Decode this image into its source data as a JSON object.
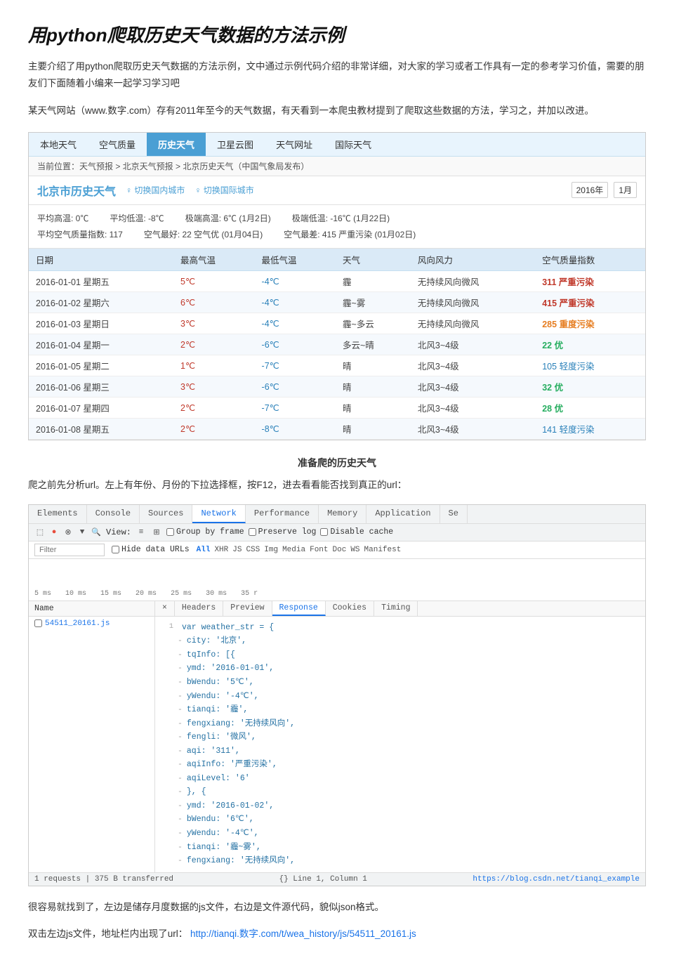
{
  "page": {
    "title_prefix": "用",
    "title_bold": "python",
    "title_suffix": "爬取历史天气数据的方法示例"
  },
  "intro": {
    "para1": "主要介绍了用python爬取历史天气数据的方法示例，文中通过示例代码介绍的非常详细，对大家的学习或者工作具有一定的参考学习价值，需要的朋友们下面随着小编来一起学习学习吧",
    "para2": "某天气网站（www.数字.com）存有2011年至今的天气数据，有天看到一本爬虫教材提到了爬取这些数据的方法，学习之，并加以改进。"
  },
  "weather_nav": {
    "items": [
      "本地天气",
      "空气质量",
      "历史天气",
      "卫星云图",
      "天气网址",
      "国际天气"
    ],
    "active": "历史天气"
  },
  "breadcrumb": {
    "text": "当前位置：天气预报 > 北京天气预报 > 北京历史天气（中国气象局发布）"
  },
  "city_header": {
    "title": "北京市历史天气",
    "switch1": "切换国内城市",
    "switch2": "切换国际城市",
    "year": "2016年",
    "month": "1月"
  },
  "stats": {
    "line1_a": "平均高温: 0℃",
    "line1_b": "平均低温: -8℃",
    "line1_c": "极端高温: 6℃ (1月2日)",
    "line1_d": "极端低温: -16℃ (1月22日)",
    "line2_a": "平均空气质量指数: 117",
    "line2_b": "空气最好: 22 空气优 (01月04日)",
    "line2_c": "空气最差: 415 严重污染 (01月02日)"
  },
  "weather_table": {
    "headers": [
      "日期",
      "最高气温",
      "最低气温",
      "天气",
      "风向风力",
      "空气质量指数"
    ],
    "rows": [
      {
        "date": "2016-01-01 星期五",
        "high": "5℃",
        "low": "-4℃",
        "weather": "霾",
        "wind": "无持续风向微风",
        "aqi": "311",
        "aqi_label": "严重污染",
        "aqi_class": "tag-red"
      },
      {
        "date": "2016-01-02 星期六",
        "high": "6℃",
        "low": "-4℃",
        "weather": "霾~雾",
        "wind": "无持续风向微风",
        "aqi": "415",
        "aqi_label": "严重污染",
        "aqi_class": "tag-red"
      },
      {
        "date": "2016-01-03 星期日",
        "high": "3℃",
        "low": "-4℃",
        "weather": "霾~多云",
        "wind": "无持续风向微风",
        "aqi": "285",
        "aqi_label": "重度污染",
        "aqi_class": "tag-orange"
      },
      {
        "date": "2016-01-04 星期一",
        "high": "2℃",
        "low": "-6℃",
        "weather": "多云~晴",
        "wind": "北风3~4级",
        "aqi": "22",
        "aqi_label": "优",
        "aqi_class": "tag-green"
      },
      {
        "date": "2016-01-05 星期二",
        "high": "1℃",
        "low": "-7℃",
        "weather": "晴",
        "wind": "北风3~4级",
        "aqi": "105",
        "aqi_label": "轻度污染",
        "aqi_class": "tag-blue"
      },
      {
        "date": "2016-01-06 星期三",
        "high": "3℃",
        "low": "-6℃",
        "weather": "晴",
        "wind": "北风3~4级",
        "aqi": "32",
        "aqi_label": "优",
        "aqi_class": "tag-green"
      },
      {
        "date": "2016-01-07 星期四",
        "high": "2℃",
        "low": "-7℃",
        "weather": "晴",
        "wind": "北风3~4级",
        "aqi": "28",
        "aqi_label": "优",
        "aqi_class": "tag-green"
      },
      {
        "date": "2016-01-08 星期五",
        "high": "2℃",
        "low": "-8℃",
        "weather": "晴",
        "wind": "北风3~4级",
        "aqi": "141",
        "aqi_label": "轻度污染",
        "aqi_class": "tag-blue"
      }
    ]
  },
  "section_heading": "准备爬的历史天气",
  "crawl_intro": "爬之前先分析url。左上有年份、月份的下拉选择框，按F12，进去看看能否找到真正的url：",
  "devtools": {
    "toolbar_icons": [
      "cursor",
      "box",
      "funnel",
      "search"
    ],
    "view_label": "View:",
    "group_by_frame": "Group by frame",
    "preserve_log": "Preserve log",
    "disable_cache": "Disable cache",
    "tabs": [
      "Elements",
      "Console",
      "Sources",
      "Network",
      "Performance",
      "Memory",
      "Application",
      "Se"
    ],
    "active_tab": "Network",
    "filter_placeholder": "Filter",
    "hide_data_urls": "Hide data URLs",
    "filter_types": [
      "All",
      "XHR",
      "JS",
      "CSS",
      "Img",
      "Media",
      "Font",
      "Doc",
      "WS",
      "Manifest"
    ],
    "active_filter": "All",
    "timeline_labels": [
      "5 ms",
      "10 ms",
      "15 ms",
      "20 ms",
      "25 ms",
      "30 ms",
      "35 r"
    ],
    "left_panel": {
      "name_header": "Name",
      "file": "54511_20161.js"
    },
    "right_panel": {
      "tabs": [
        "×",
        "Headers",
        "Preview",
        "Response",
        "Cookies",
        "Timing"
      ],
      "active_tab": "Response"
    },
    "code_lines": [
      {
        "ln": "1",
        "dash": "",
        "content": "var weather_str = {"
      },
      {
        "ln": "",
        "dash": "-",
        "content": "    city: '北京',"
      },
      {
        "ln": "",
        "dash": "-",
        "content": "    tqInfo: [{"
      },
      {
        "ln": "",
        "dash": "-",
        "content": "        ymd: '2016-01-01',"
      },
      {
        "ln": "",
        "dash": "-",
        "content": "        bWendu: '5℃',"
      },
      {
        "ln": "",
        "dash": "-",
        "content": "        yWendu: '-4℃',"
      },
      {
        "ln": "",
        "dash": "-",
        "content": "        tianqi: '霾',"
      },
      {
        "ln": "",
        "dash": "-",
        "content": "        fengxiang: '无持续风向',"
      },
      {
        "ln": "",
        "dash": "-",
        "content": "        fengli: '微风',"
      },
      {
        "ln": "",
        "dash": "-",
        "content": "        aqi: '311',"
      },
      {
        "ln": "",
        "dash": "-",
        "content": "        aqiInfo: '严重污染',"
      },
      {
        "ln": "",
        "dash": "-",
        "content": "        aqiLevel: '6'"
      },
      {
        "ln": "",
        "dash": "-",
        "content": "    }, {"
      },
      {
        "ln": "",
        "dash": "-",
        "content": "        ymd: '2016-01-02',"
      },
      {
        "ln": "",
        "dash": "-",
        "content": "        bWendu: '6℃',"
      },
      {
        "ln": "",
        "dash": "-",
        "content": "        yWendu: '-4℃',"
      },
      {
        "ln": "",
        "dash": "-",
        "content": "        tianqi: '霾~雾',"
      },
      {
        "ln": "",
        "dash": "-",
        "content": "        fengxiang: '无持续风向',"
      }
    ],
    "statusbar_left": "1 requests | 375 B transferred",
    "statusbar_right": "{}  Line 1, Column 1",
    "statusbar_url": "https://blog.csdn.net/tianqi_example"
  },
  "bottom": {
    "para1": "很容易就找到了，左边是储存月度数据的js文件，右边是文件源代码，貌似json格式。",
    "para2_prefix": "双击左边js文件，地址栏内出现了url：",
    "para2_url": "http://tianqi.数字.com/t/wea_history/js/54511_20161.js"
  }
}
